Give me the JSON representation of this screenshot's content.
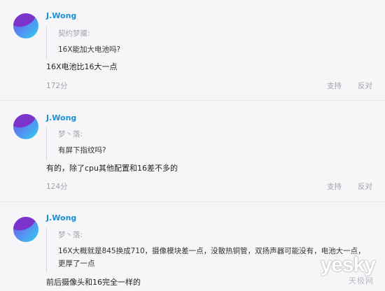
{
  "comments": [
    {
      "username": "J.Wong",
      "quote_author": "契约梦魇:",
      "quote_text": "16X能加大电池吗?",
      "reply": "16X电池比16大一点",
      "likes": "172分",
      "support_label": "支持",
      "oppose_label": "反对"
    },
    {
      "username": "J.Wong",
      "quote_author": "梦丶落:",
      "quote_text": "有屏下指纹吗?",
      "reply": "有的，除了cpu其他配置和16差不多的",
      "likes": "124分",
      "support_label": "支持",
      "oppose_label": "反对"
    },
    {
      "username": "J.Wong",
      "quote_author": "梦丶落:",
      "quote_text": "16X大概就是845换成710，摄像模块差一点，没散热铜管，双扬声器可能没有，电池大一点，更厚了一点",
      "reply": "前后摄像头和16完全一样的"
    }
  ],
  "watermark": {
    "brand": "yesky",
    "sub": "天极网"
  },
  "colors": {
    "username": "#1a8fd6",
    "background": "#f6f6f8",
    "muted": "#a0a0a8"
  }
}
